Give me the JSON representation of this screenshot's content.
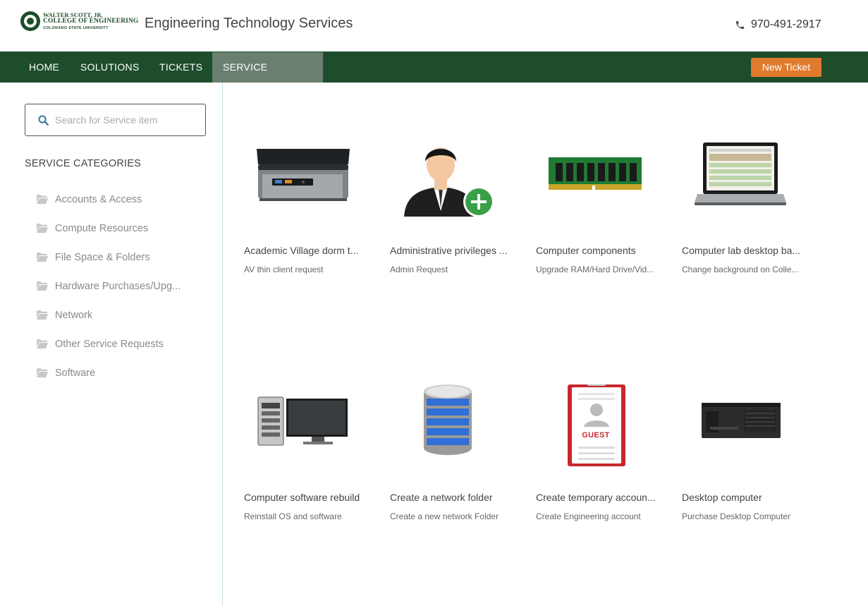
{
  "header": {
    "logo": {
      "line1": "WALTER SCOTT, JR.",
      "line2": "COLLEGE OF ENGINEERING",
      "line3": "COLORADO STATE UNIVERSITY"
    },
    "site_title": "Engineering Technology Services",
    "phone": "970-491-2917",
    "phone_icon": "phone-icon"
  },
  "nav": {
    "items": [
      {
        "label": "HOME"
      },
      {
        "label": "SOLUTIONS"
      },
      {
        "label": "TICKETS"
      },
      {
        "label": "SERVICE CATALOG",
        "active": true
      }
    ],
    "new_ticket": "New Ticket"
  },
  "sidebar": {
    "search_placeholder": "Search for Service item",
    "categories_title": "SERVICE CATEGORIES",
    "categories": [
      {
        "label": "Accounts & Access"
      },
      {
        "label": "Compute Resources"
      },
      {
        "label": "File Space & Folders"
      },
      {
        "label": "Hardware Purchases/Upg..."
      },
      {
        "label": "Network"
      },
      {
        "label": "Other Service Requests"
      },
      {
        "label": "Software"
      }
    ]
  },
  "catalog": {
    "items": [
      {
        "name": "Academic Village dorm t...",
        "desc": "AV thin client request",
        "icon": "mini-pc-icon"
      },
      {
        "name": "Administrative privileges ...",
        "desc": "Admin Request",
        "icon": "admin-user-icon"
      },
      {
        "name": "Computer components",
        "desc": "Upgrade RAM/Hard Drive/Vid...",
        "icon": "ram-module-icon"
      },
      {
        "name": "Computer lab desktop ba...",
        "desc": "Change background on Colle...",
        "icon": "laptop-icon"
      },
      {
        "name": "Computer software rebuild",
        "desc": "Reinstall OS and software",
        "icon": "desktop-monitor-icon"
      },
      {
        "name": "Create a network folder",
        "desc": "Create a new network Folder",
        "icon": "database-icon"
      },
      {
        "name": "Create temporary accoun...",
        "desc": "Create Engineering account",
        "icon": "guest-badge-icon"
      },
      {
        "name": "Desktop computer",
        "desc": "Purchase Desktop Computer",
        "icon": "workstation-icon"
      }
    ],
    "guest_label": "GUEST"
  },
  "colors": {
    "brand_green": "#1e4d2b",
    "nav_active": "#6a7f70",
    "accent_orange": "#e07a2c"
  }
}
